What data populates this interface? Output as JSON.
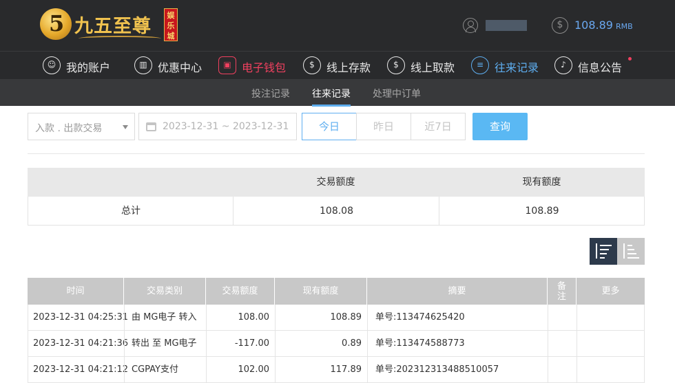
{
  "brand": {
    "logo_mark": "5",
    "name": "九五至尊",
    "badge": [
      "娱",
      "乐",
      "城"
    ]
  },
  "account": {
    "username_masked": "",
    "balance": "108.89",
    "currency": "RMB",
    "coin_symbol": "$"
  },
  "nav": [
    {
      "label": "我的账户",
      "icon": "user-icon"
    },
    {
      "label": "优惠中心",
      "icon": "gift-icon"
    },
    {
      "label": "电子钱包",
      "icon": "wallet-icon"
    },
    {
      "label": "线上存款",
      "icon": "deposit-icon"
    },
    {
      "label": "线上取款",
      "icon": "withdraw-icon"
    },
    {
      "label": "往来记录",
      "icon": "records-icon"
    },
    {
      "label": "信息公告",
      "icon": "bell-icon"
    }
  ],
  "subtabs": [
    "投注记录",
    "往来记录",
    "处理中订单"
  ],
  "filters": {
    "type_select": "入款 . 出款交易",
    "date_range": "2023-12-31 ~ 2023-12-31",
    "quick": [
      "今日",
      "昨日",
      "近7日"
    ],
    "search": "查询"
  },
  "summary": {
    "headers": [
      "交易额度",
      "现有额度"
    ],
    "row_label": "总计",
    "trade_amount": "108.08",
    "current_amount": "108.89"
  },
  "records": {
    "headers": [
      "时间",
      "交易类别",
      "交易额度",
      "现有额度",
      "摘要",
      "备注",
      "更多"
    ],
    "rows": [
      {
        "time": "2023-12-31 04:25:31",
        "type": "由 MG电子 转入",
        "amount": "108.00",
        "balance": "108.89",
        "summary": "单号:113474625420",
        "note": "",
        "more": ""
      },
      {
        "time": "2023-12-31 04:21:36",
        "type": "转出 至 MG电子",
        "amount": "-117.00",
        "balance": "0.89",
        "summary": "单号:113474588773",
        "note": "",
        "more": ""
      },
      {
        "time": "2023-12-31 04:21:12",
        "type": "CGPAY支付",
        "amount": "102.00",
        "balance": "117.89",
        "summary": "单号:202312313488510057",
        "note": "",
        "more": ""
      }
    ]
  },
  "colors": {
    "header_bg": "#292a2c",
    "accent_blue": "#5eaef0",
    "accent_red": "#f0405f",
    "brand_gold": "#f0c24f"
  }
}
